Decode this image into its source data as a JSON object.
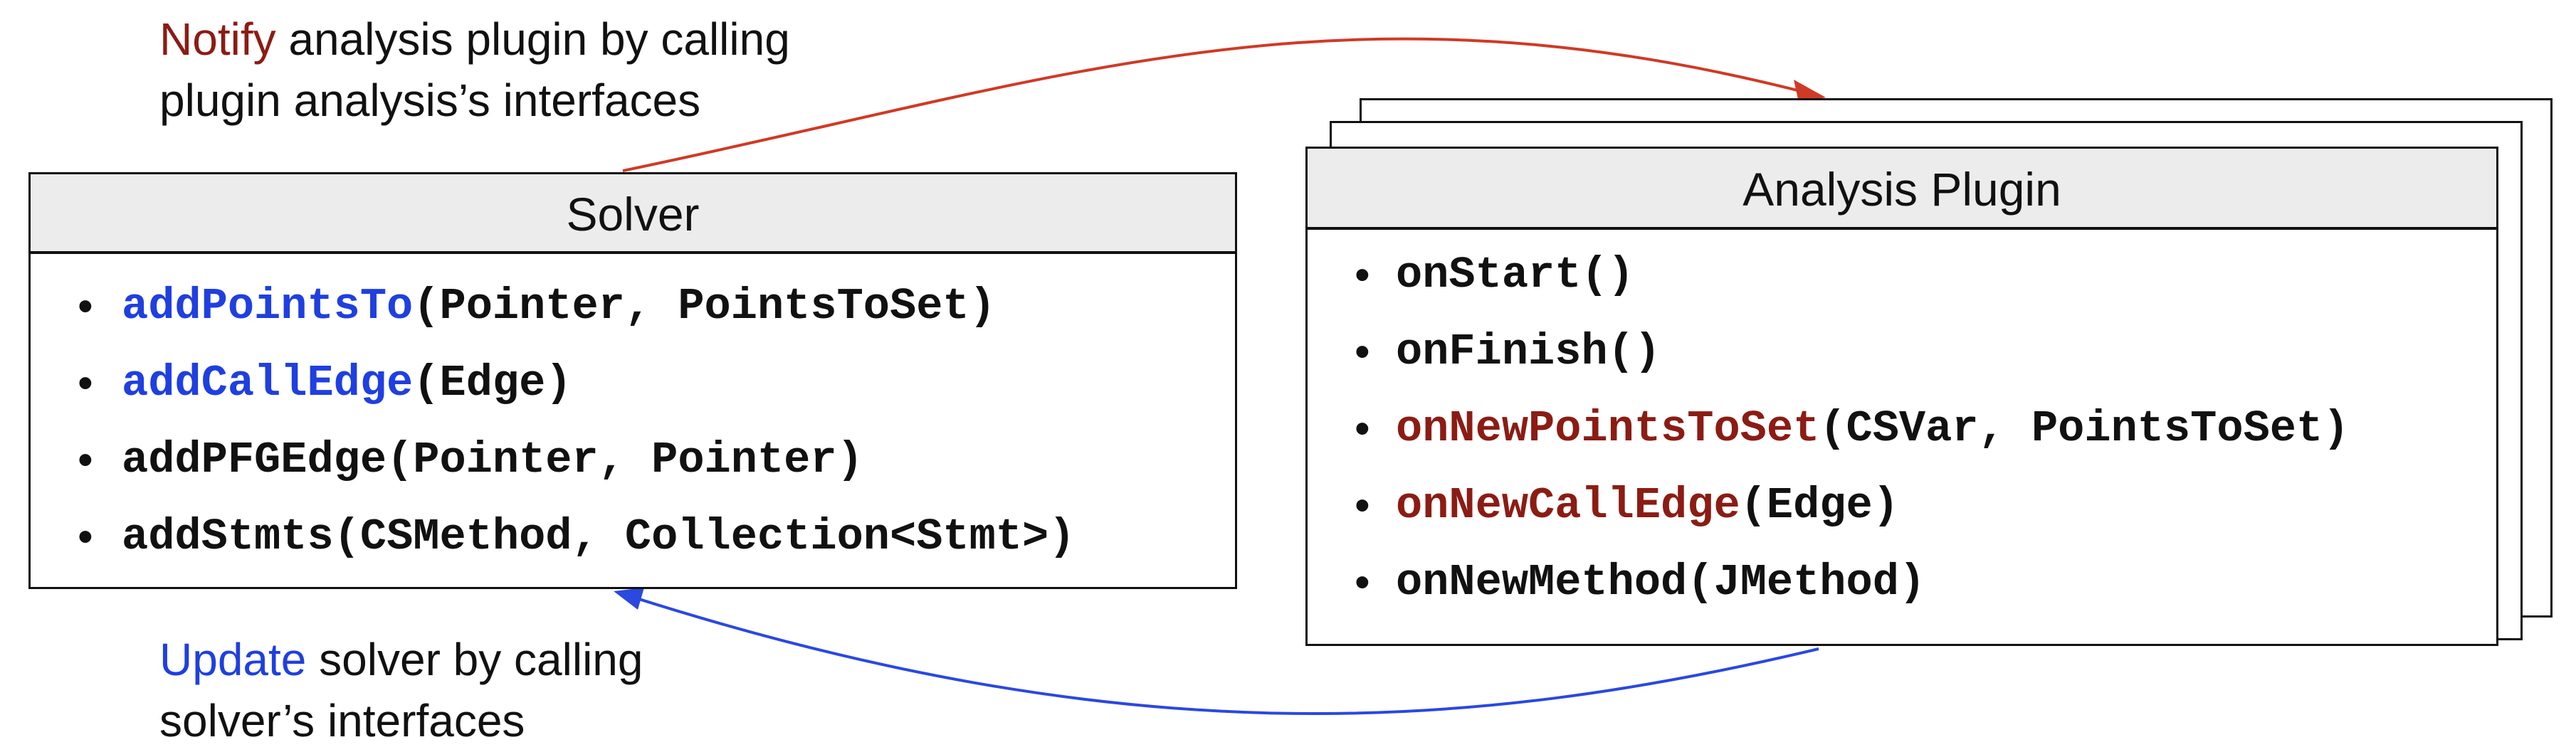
{
  "top_caption": {
    "keyword": "Notify",
    "line1_rest": " analysis plugin by calling",
    "line2": "plugin analysis’s interfaces"
  },
  "bottom_caption": {
    "keyword": "Update",
    "line1_rest": " solver by calling",
    "line2": "solver’s interfaces"
  },
  "solver": {
    "title": "Solver",
    "methods": [
      {
        "name": "addPointsTo",
        "args": "(Pointer, PointsToSet)",
        "highlight": "blue"
      },
      {
        "name": "addCallEdge",
        "args": "(Edge)",
        "highlight": "blue"
      },
      {
        "name": "addPFGEdge",
        "args": "(Pointer, Pointer)",
        "highlight": "none"
      },
      {
        "name": "addStmts",
        "args": "(CSMethod, Collection<Stmt>)",
        "highlight": "none"
      }
    ]
  },
  "analysis_plugin": {
    "title": "Analysis Plugin",
    "methods": [
      {
        "name": "onStart",
        "args": "()",
        "highlight": "none"
      },
      {
        "name": "onFinish",
        "args": "()",
        "highlight": "none"
      },
      {
        "name": "onNewPointsToSet",
        "args": "(CSVar, PointsToSet)",
        "highlight": "red"
      },
      {
        "name": "onNewCallEdge",
        "args": "(Edge)",
        "highlight": "red"
      },
      {
        "name": "onNewMethod",
        "args": "(JMethod)",
        "highlight": "none"
      }
    ]
  },
  "bullet_char": "•",
  "colors": {
    "notify_red": "#8b1c14",
    "update_blue": "#1f3fe0",
    "arrow_red": "#cf3a26",
    "arrow_blue": "#2b48e0",
    "header_fill": "#ececec"
  }
}
